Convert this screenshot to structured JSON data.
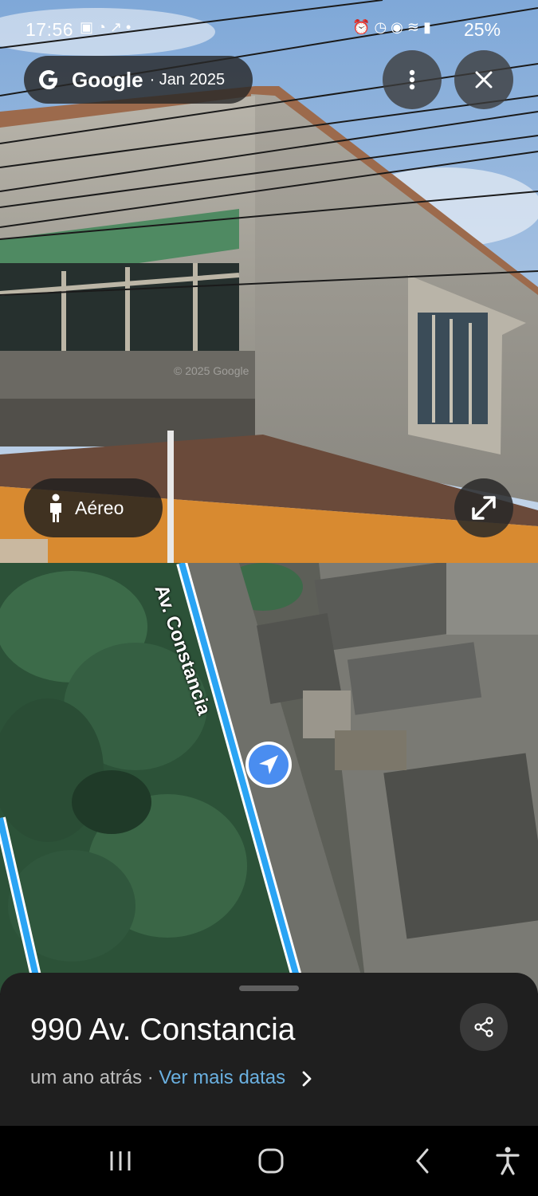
{
  "status_bar": {
    "time": "17:56",
    "left_icons": [
      "image-icon",
      "sync-icon",
      "trend-icon",
      "dot-icon"
    ],
    "right_icons": [
      "alarm-icon",
      "clock-icon",
      "location-icon",
      "wifi-icon",
      "signal-icon"
    ],
    "battery": "25%"
  },
  "street_view": {
    "source": "Google",
    "date": "· Jan 2025",
    "watermark": "© 2025 Google",
    "aerial_label": "Aéreo"
  },
  "map": {
    "street_name": "Av. Constancia"
  },
  "sheet": {
    "address": "990 Av. Constancia",
    "age": "um ano atrás ·",
    "more_dates": "Ver mais datas"
  },
  "colors": {
    "link": "#6ab0e0",
    "route": "#2aa4f4",
    "marker": "#4a8df0"
  }
}
